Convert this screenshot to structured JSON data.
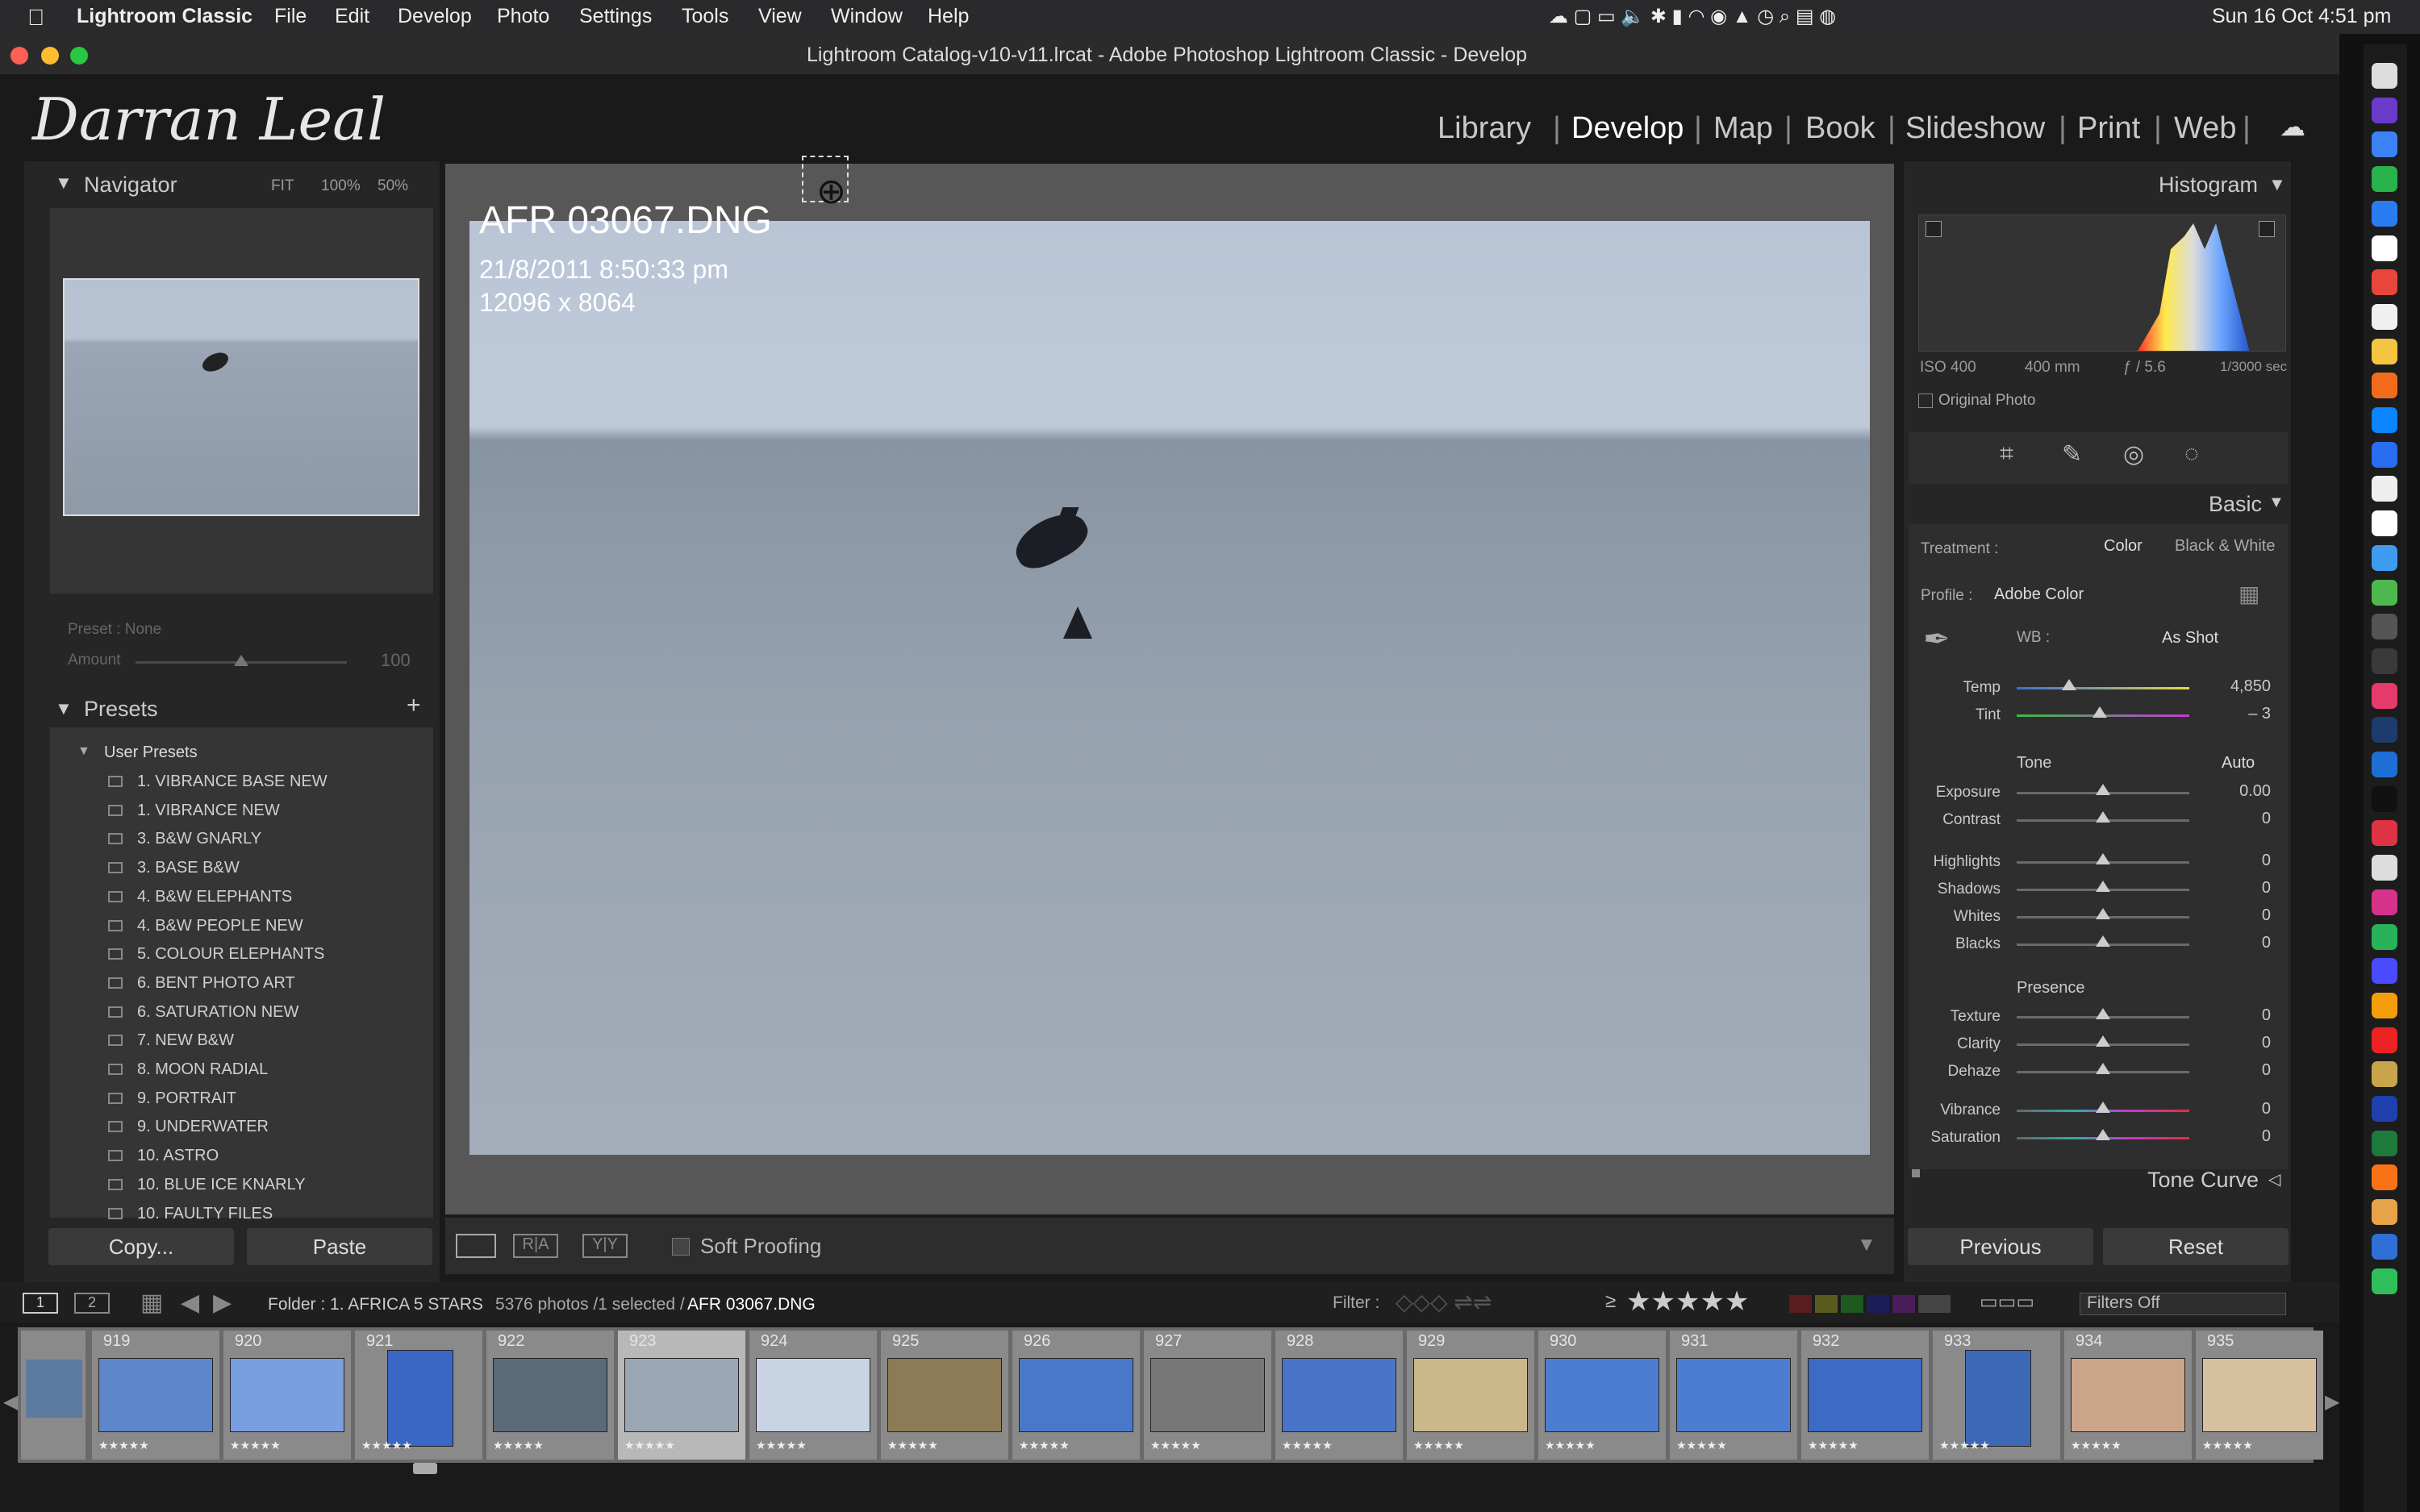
{
  "menubar": {
    "apple": "",
    "app": "Lightroom Classic",
    "items": [
      "File",
      "Edit",
      "Develop",
      "Photo",
      "Settings",
      "Tools",
      "View",
      "Window",
      "Help"
    ],
    "datetime": "Sun 16 Oct  4:51 pm"
  },
  "window": {
    "title": "Lightroom Catalog-v10-v11.lrcat - Adobe Photoshop Lightroom Classic - Develop"
  },
  "identity_plate": "Darran Leal",
  "modules": [
    "Library",
    "Develop",
    "Map",
    "Book",
    "Slideshow",
    "Print",
    "Web"
  ],
  "active_module": "Develop",
  "navigator": {
    "title": "Navigator",
    "zoom_options": [
      "FIT",
      "100%",
      "50%"
    ]
  },
  "preset_amount": {
    "preset_label": "Preset : None",
    "amount_label": "Amount",
    "amount_value": "100"
  },
  "presets": {
    "title": "Presets",
    "group": "User Presets",
    "items": [
      "1. VIBRANCE BASE NEW",
      "1. VIBRANCE NEW",
      "3. B&W GNARLY",
      "3. BASE B&W",
      "4. B&W ELEPHANTS",
      "4. B&W PEOPLE NEW",
      "5. COLOUR ELEPHANTS",
      "6. BENT PHOTO ART",
      "6. SATURATION NEW",
      "7. NEW B&W",
      "8. MOON RADIAL",
      "9. PORTRAIT",
      "9. UNDERWATER",
      "10. ASTRO",
      "10. BLUE ICE KNARLY",
      "10. FAULTY FILES"
    ]
  },
  "left_buttons": {
    "copy": "Copy...",
    "paste": "Paste"
  },
  "photo": {
    "filename": "AFR 03067.DNG",
    "datetime": "21/8/2011 8:50:33 pm",
    "dimensions": "12096 x 8064"
  },
  "toolbar": {
    "soft_proofing": "Soft Proofing"
  },
  "histogram": {
    "title": "Histogram",
    "iso": "ISO 400",
    "focal": "400 mm",
    "aperture": "ƒ / 5.6",
    "shutter": "1/3000 sec",
    "original_photo": "Original Photo"
  },
  "basic": {
    "title": "Basic",
    "treatment_label": "Treatment :",
    "color": "Color",
    "bw": "Black & White",
    "profile_label": "Profile :",
    "profile_value": "Adobe Color",
    "wb_label": "WB :",
    "wb_value": "As Shot",
    "temp": {
      "label": "Temp",
      "value": "4,850"
    },
    "tint": {
      "label": "Tint",
      "value": "– 3"
    },
    "tone_label": "Tone",
    "auto": "Auto",
    "sliders": [
      {
        "label": "Exposure",
        "value": "0.00"
      },
      {
        "label": "Contrast",
        "value": "0"
      },
      {
        "label": "Highlights",
        "value": "0"
      },
      {
        "label": "Shadows",
        "value": "0"
      },
      {
        "label": "Whites",
        "value": "0"
      },
      {
        "label": "Blacks",
        "value": "0"
      }
    ],
    "presence_label": "Presence",
    "presence": [
      {
        "label": "Texture",
        "value": "0"
      },
      {
        "label": "Clarity",
        "value": "0"
      },
      {
        "label": "Dehaze",
        "value": "0"
      },
      {
        "label": "Vibrance",
        "value": "0"
      },
      {
        "label": "Saturation",
        "value": "0"
      }
    ]
  },
  "tone_curve": {
    "title": "Tone Curve"
  },
  "right_buttons": {
    "previous": "Previous",
    "reset": "Reset"
  },
  "filmstrip_bar": {
    "view1": "1",
    "view2": "2",
    "folder": "Folder : 1. AFRICA 5 STARS",
    "count": "5376 photos /1 selected /",
    "selected_file": "AFR 03067.DNG",
    "filter_label": "Filter :",
    "filters_off": "Filters Off",
    "rating_op": "≥"
  },
  "filmstrip": {
    "numbers": [
      "919",
      "920",
      "921",
      "922",
      "923",
      "924",
      "925",
      "926",
      "927",
      "928",
      "929",
      "930",
      "931",
      "932",
      "933",
      "934",
      "935"
    ],
    "stars": "★★★★★"
  },
  "colors": {
    "accent": "#e8e8e8",
    "panel": "#2d2d2d",
    "center": "#575757"
  }
}
